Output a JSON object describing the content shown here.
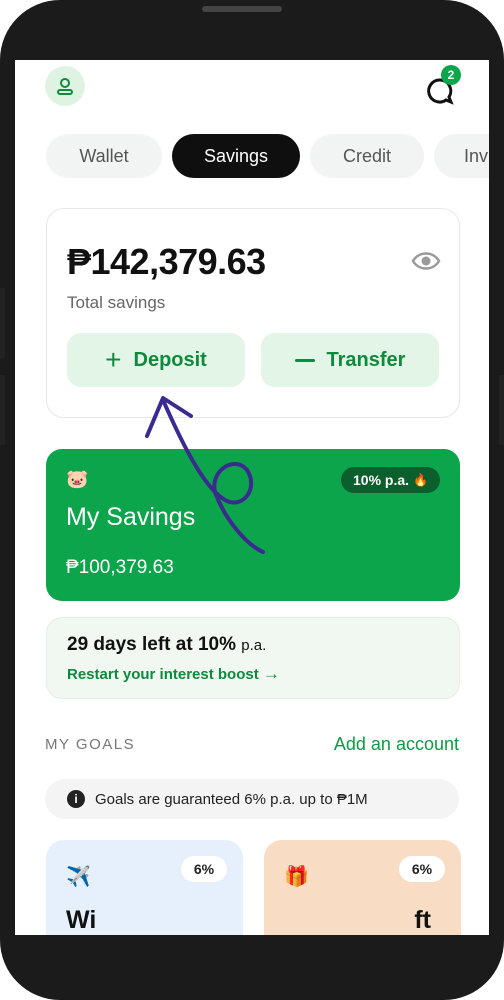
{
  "header": {
    "chat_badge": "2"
  },
  "tabs": [
    {
      "label": "Wallet",
      "active": false
    },
    {
      "label": "Savings",
      "active": true
    },
    {
      "label": "Credit",
      "active": false
    },
    {
      "label": "Inv",
      "active": false
    }
  ],
  "balance": {
    "amount": "₱142,379.63",
    "label": "Total savings",
    "deposit_label": "Deposit",
    "transfer_label": "Transfer"
  },
  "my_savings": {
    "emoji": "🐷",
    "rate": "10% p.a.",
    "rate_emoji": "🔥",
    "title": "My Savings",
    "amount": "₱100,379.63"
  },
  "boost": {
    "days_left": "29 days left at 10%",
    "suffix": "p.a.",
    "link": "Restart your interest boost"
  },
  "goals": {
    "heading": "MY GOALS",
    "add_account": "Add an account",
    "notice": "Goals are guaranteed 6% p.a. up to ₱1M",
    "cards": [
      {
        "emoji": "✈️",
        "rate": "6%",
        "title_fragment": "Wi"
      },
      {
        "emoji": "🎁",
        "rate": "6%",
        "title_fragment": "ft"
      }
    ]
  },
  "colors": {
    "brand_green": "#0da54b",
    "dark_tab": "#0f0f0f",
    "annotation": "#3b2a8f"
  },
  "icons": {
    "nav": [
      "home-icon",
      "scan-icon",
      "apps-icon"
    ]
  }
}
